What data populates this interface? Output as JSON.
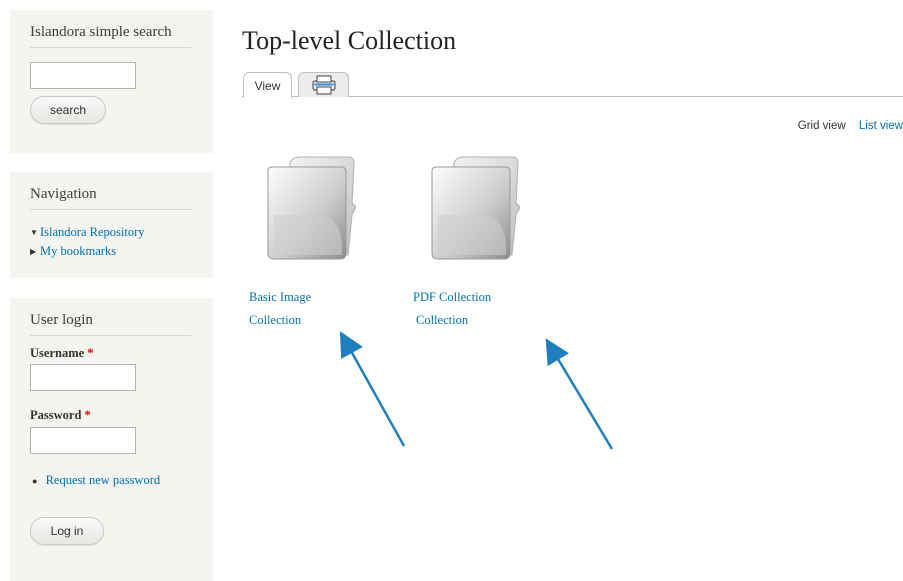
{
  "sidebar": {
    "search_block": {
      "title": "Islandora simple search",
      "input_value": "",
      "button_label": "search"
    },
    "navigation_block": {
      "title": "Navigation",
      "items": [
        {
          "label": "Islandora Repository",
          "expanded": true
        },
        {
          "label": "My bookmarks",
          "expanded": false
        }
      ]
    },
    "login_block": {
      "title": "User login",
      "username_label": "Username",
      "password_label": "Password",
      "required_marker": "*",
      "request_password_link": "Request new password",
      "login_button": "Log in"
    }
  },
  "main": {
    "title": "Top-level Collection",
    "tabs": [
      {
        "label": "View",
        "active": true
      },
      {
        "label": "",
        "icon": "print-icon",
        "active": false
      }
    ],
    "view_switch": {
      "grid": "Grid view",
      "list": "List view"
    },
    "objects": [
      {
        "title_line1": "Basic Image",
        "title_line2": "Collection",
        "icon": "folder-icon"
      },
      {
        "title_line1": "PDF Collection",
        "title_line2": "Collection",
        "icon": "folder-icon"
      }
    ]
  },
  "colors": {
    "link": "#0071b3",
    "sidebar_bg": "#f4f4f1",
    "arrow": "#1f7fbf",
    "required": "#ee0000"
  }
}
